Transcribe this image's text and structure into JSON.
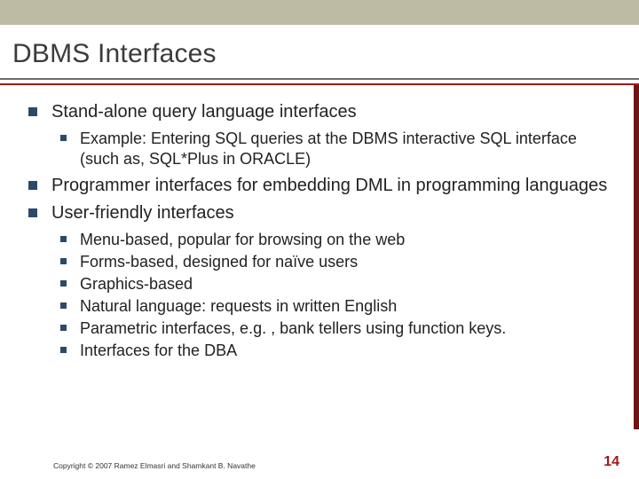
{
  "slide": {
    "title": "DBMS Interfaces",
    "bullets": [
      {
        "text": "Stand-alone query language interfaces",
        "children": [
          {
            "text": "Example: Entering SQL queries at the DBMS interactive SQL interface (such as, SQL*Plus in ORACLE)"
          }
        ]
      },
      {
        "text": "Programmer interfaces for embedding DML in programming languages",
        "children": []
      },
      {
        "text": "User-friendly interfaces",
        "children": [
          {
            "text": "Menu-based, popular for browsing on the web"
          },
          {
            "text": "Forms-based, designed for naïve users"
          },
          {
            "text": "Graphics-based"
          },
          {
            "text": "Natural language: requests in written English"
          },
          {
            "text": "Parametric interfaces, e.g. , bank tellers using function keys."
          },
          {
            "text": "Interfaces for the DBA"
          }
        ]
      }
    ],
    "copyright": "Copyright © 2007 Ramez Elmasri and Shamkant B. Navathe",
    "page_number": "14"
  },
  "colors": {
    "topband": "#bdbba3",
    "accent_rule": "#9a1b1b",
    "bullet": "#2b4a6a",
    "side_stripe": "#701515",
    "pagenum": "#a11a1a"
  }
}
